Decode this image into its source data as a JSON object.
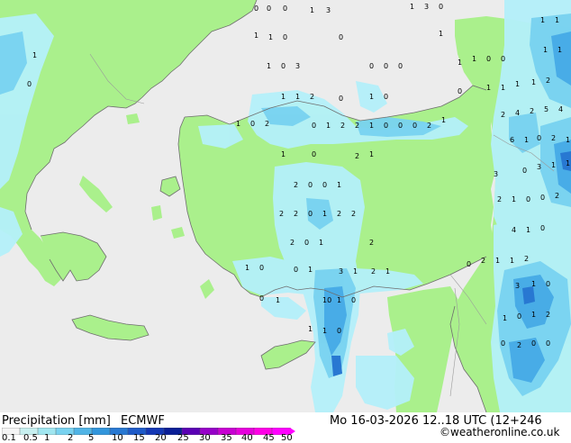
{
  "map": {
    "region": "Eastern Mediterranean / Aegean / Anatolia",
    "colors": {
      "sea": "#ececec",
      "land": "#aaf08c",
      "coast": "#6e6e6e",
      "precip_light": "#b4f0fa",
      "precip_mid": "#78d2f0",
      "precip_heavy": "#46aae6",
      "precip_strong": "#2878d2"
    },
    "precip_values": [
      "0",
      "0",
      "0",
      "1",
      "3",
      "1",
      "3",
      "0",
      "1",
      "1",
      "1",
      "1",
      "0",
      "0",
      "1",
      "1",
      "0",
      "3",
      "0",
      "0",
      "0",
      "1",
      "1",
      "0",
      "0",
      "1",
      "1",
      "1",
      "0",
      "1",
      "1",
      "2",
      "0",
      "1",
      "0",
      "0",
      "1",
      "1",
      "1",
      "1",
      "2",
      "1",
      "0",
      "2",
      "0",
      "1",
      "2",
      "2",
      "1",
      "0",
      "0",
      "0",
      "2",
      "1",
      "2",
      "4",
      "2",
      "5",
      "4",
      "6",
      "1",
      "0",
      "2",
      "1",
      "1",
      "0",
      "2",
      "1",
      "3",
      "0",
      "3",
      "1",
      "1",
      "2",
      "0",
      "0",
      "1",
      "2",
      "1",
      "0",
      "0",
      "2",
      "2",
      "2",
      "0",
      "1",
      "2",
      "2",
      "4",
      "1",
      "0",
      "2",
      "0",
      "1",
      "2",
      "0",
      "2",
      "1",
      "1",
      "2",
      "1",
      "0",
      "0",
      "1",
      "3",
      "1",
      "2",
      "1",
      "3",
      "1",
      "0",
      "0",
      "1",
      "10",
      "1",
      "0",
      "1",
      "0",
      "1",
      "2",
      "1",
      "1",
      "0",
      "0",
      "2",
      "0",
      "0"
    ]
  },
  "footer": {
    "title": "Precipitation [mm]",
    "model": "ECMWF",
    "datetime": "Mo 16-03-2026 12..18 UTC (12+246",
    "credit": "©weatheronline.co.uk",
    "legend_colors": [
      "#f5f5f5",
      "#c8f0f0",
      "#a0e6f0",
      "#78d2f0",
      "#50b4e6",
      "#3296dc",
      "#2878d2",
      "#1e5ac8",
      "#1437b4",
      "#0a1e96",
      "#5a00b4",
      "#9600c8",
      "#c800d2",
      "#e600dc",
      "#ff00e6",
      "#ff00ff"
    ],
    "legend_labels": [
      "0.1",
      "0.5",
      "1",
      "2",
      "5",
      "10",
      "15",
      "20",
      "25",
      "30",
      "35",
      "40",
      "45",
      "50"
    ]
  }
}
